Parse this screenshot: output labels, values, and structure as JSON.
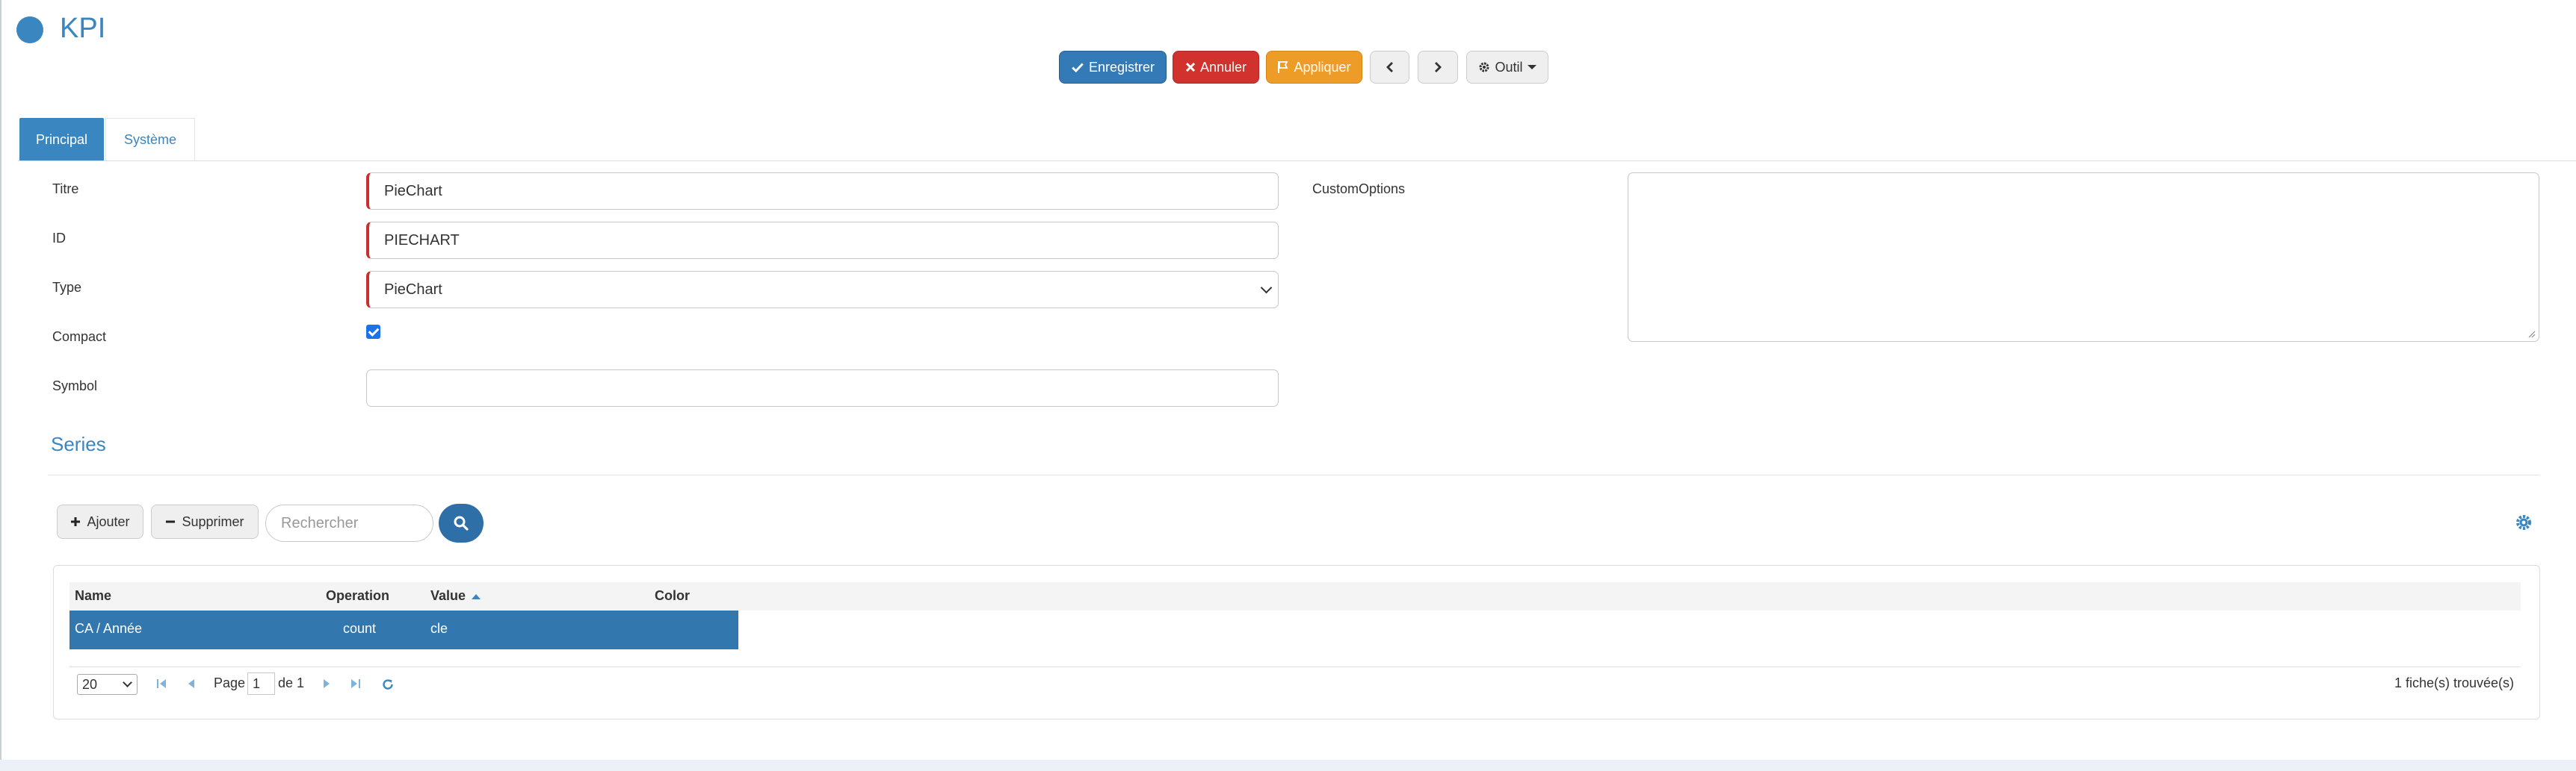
{
  "header": {
    "title": "KPI"
  },
  "toolbar": {
    "save_label": "Enregistrer",
    "cancel_label": "Annuler",
    "apply_label": "Appliquer",
    "tool_label": "Outil"
  },
  "tabs": [
    {
      "label": "Principal",
      "active": true
    },
    {
      "label": "Système",
      "active": false
    }
  ],
  "form": {
    "titre": {
      "label": "Titre",
      "value": "PieChart"
    },
    "id": {
      "label": "ID",
      "value": "PIECHART"
    },
    "type": {
      "label": "Type",
      "value": "PieChart"
    },
    "compact": {
      "label": "Compact",
      "checked": true
    },
    "symbol": {
      "label": "Symbol",
      "value": ""
    },
    "custom_options": {
      "label": "CustomOptions",
      "value": ""
    }
  },
  "series": {
    "title": "Series",
    "add_label": "Ajouter",
    "delete_label": "Supprimer",
    "search_placeholder": "Rechercher",
    "columns": [
      "Name",
      "Operation",
      "Value",
      "Color"
    ],
    "sorted_column": "Value",
    "rows": [
      {
        "name": "CA / Année",
        "operation": "count",
        "value": "cle",
        "color": ""
      }
    ],
    "pager": {
      "page_size": "20",
      "page_label": "Page",
      "current_page": "1",
      "of_label": "de 1",
      "found_label": "1 fiche(s) trouvée(s)"
    }
  },
  "colors": {
    "accent": "#3a86c0",
    "primary_button": "#337ab7",
    "danger_button": "#d2322d",
    "warning_button": "#ed9c28",
    "selected_row": "#3277ae"
  }
}
